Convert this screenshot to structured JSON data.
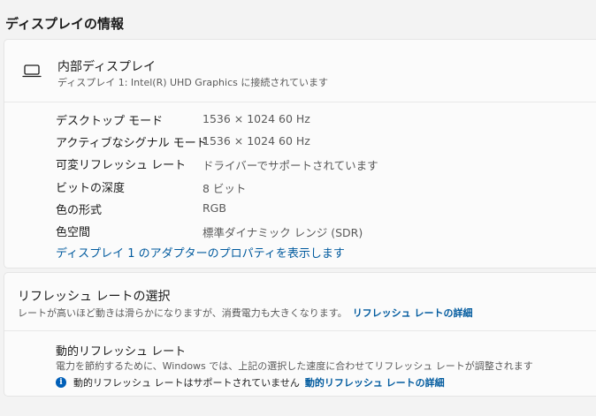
{
  "page": {
    "title": "ディスプレイの情報"
  },
  "display": {
    "icon": "laptop-icon",
    "name": "内部ディスプレイ",
    "description": "ディスプレイ 1: Intel(R) UHD Graphics に接続されています",
    "specs": [
      {
        "label": "デスクトップ モード",
        "value": "1536 × 1024 60 Hz"
      },
      {
        "label": "アクティブなシグナル モード",
        "value": "1536 × 1024 60 Hz"
      },
      {
        "label": "可変リフレッシュ レート",
        "value": "ドライバーでサポートされています"
      },
      {
        "label": "ビットの深度",
        "value": "8 ビット"
      },
      {
        "label": "色の形式",
        "value": "RGB"
      },
      {
        "label": "色空間",
        "value": "標準ダイナミック レンジ (SDR)"
      }
    ],
    "adapter_link": "ディスプレイ 1 のアダプターのプロパティを表示します"
  },
  "refresh": {
    "title": "リフレッシュ レートの選択",
    "description": "レートが高いほど動きは滑らかになりますが、消費電力も大きくなります。",
    "details_link": "リフレッシュ レートの詳細"
  },
  "dynamic": {
    "title": "動的リフレッシュ レート",
    "description": "電力を節約するために、Windows では、上記の選択した速度に合わせてリフレッシュ レートが調整されます",
    "status": "動的リフレッシュ レートはサポートされていません",
    "details_link": "動的リフレッシュ レートの詳細",
    "info_icon": "info-icon",
    "accent_color": "#005fb8"
  }
}
